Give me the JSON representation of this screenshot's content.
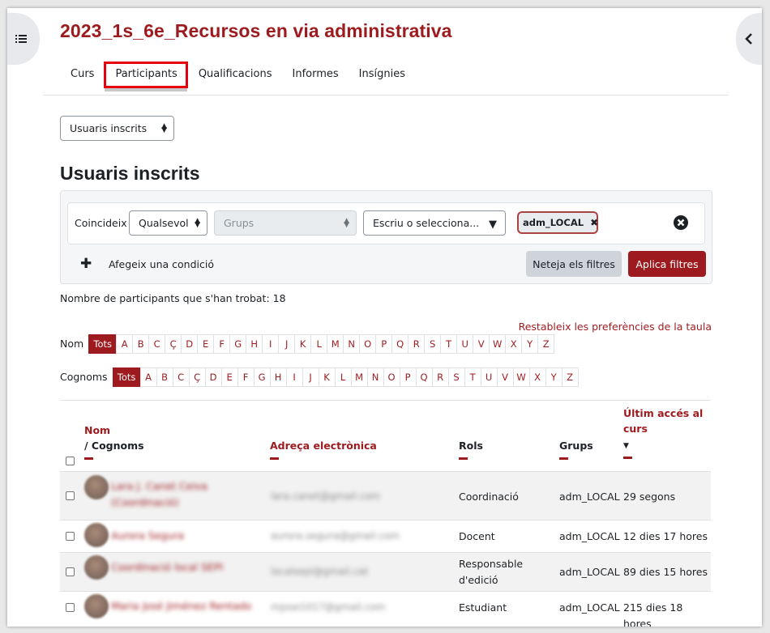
{
  "course_title": "2023_1s_6e_Recursos en via administrativa",
  "tabs": [
    "Curs",
    "Participants",
    "Qualificacions",
    "Informes",
    "Insígnies"
  ],
  "view_select": "Usuaris inscrits",
  "section_heading": "Usuaris inscrits",
  "filter": {
    "match_label": "Coincideix",
    "match_value": "Qualsevol",
    "type_value": "Grups",
    "search_placeholder": "Escriu o selecciona...",
    "selected_pill": "adm_LOCAL",
    "add_condition": "Afegeix una condició",
    "clear_button": "Neteja els filtres",
    "apply_button": "Aplica filtres"
  },
  "participant_count": "Nombre de participants que s'han trobat: 18",
  "reset_prefs": "Restableix les preferències de la taula",
  "first_name_label": "Nom",
  "last_name_label": "Cognoms",
  "all_label": "Tots",
  "letters": [
    "A",
    "B",
    "C",
    "Ç",
    "D",
    "E",
    "F",
    "G",
    "H",
    "I",
    "J",
    "K",
    "L",
    "M",
    "N",
    "O",
    "P",
    "Q",
    "R",
    "S",
    "T",
    "U",
    "V",
    "W",
    "X",
    "Y",
    "Z"
  ],
  "columns": {
    "name": "Nom",
    "surname": "/ Cognoms",
    "email": "Adreça electrònica",
    "roles": "Rols",
    "groups": "Grups",
    "last_access": "Últim accés al curs"
  },
  "rows": [
    {
      "name": "Lara J. Canet Ceiva (Coordinació)",
      "email": "lara.canet@gmail.com",
      "role": "Coordinació",
      "group": "adm_LOCAL",
      "access": "29 segons"
    },
    {
      "name": "Aurora Segura",
      "email": "aurora.segura@gmail.com",
      "role": "Docent",
      "group": "adm_LOCAL",
      "access": "12 dies 17 hores"
    },
    {
      "name": "Coordinació local SEPI",
      "email": "localsepi@gmail.cat",
      "role": "Responsable d'edició",
      "group": "adm_LOCAL",
      "access": "89 dies 15 hores"
    },
    {
      "name": "Maria José Jiménez Rentado",
      "email": "mjose1017@gmail.com",
      "role": "Estudiant",
      "group": "adm_LOCAL",
      "access": "215 dies 18 hores"
    }
  ],
  "colors": {
    "brand": "#9d1b1f",
    "highlight_box": "#e5000b"
  }
}
